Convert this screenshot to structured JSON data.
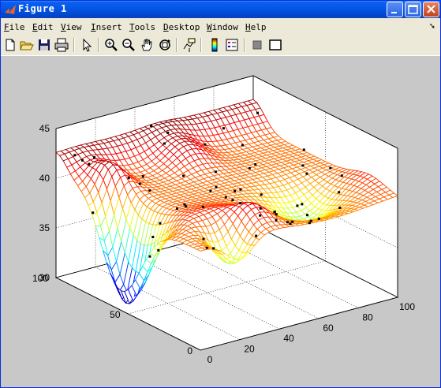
{
  "window": {
    "title": "Figure 1"
  },
  "menu": {
    "items": [
      {
        "u": "F",
        "rest": "ile"
      },
      {
        "u": "E",
        "rest": "dit"
      },
      {
        "u": "V",
        "rest": "iew"
      },
      {
        "u": "I",
        "rest": "nsert"
      },
      {
        "u": "T",
        "rest": "ools"
      },
      {
        "u": "D",
        "rest": "esktop"
      },
      {
        "u": "W",
        "rest": "indow"
      },
      {
        "u": "H",
        "rest": "elp"
      }
    ]
  },
  "toolbar": {
    "tools": [
      "new-figure-icon",
      "open-file-icon",
      "save-icon",
      "print-icon",
      "edit-plot-arrow-icon",
      "zoom-in-icon",
      "zoom-out-icon",
      "pan-hand-icon",
      "rotate-3d-icon",
      "data-cursor-icon",
      "colorbar-icon",
      "legend-icon",
      "hide-plot-tools-icon",
      "show-plot-tools-icon"
    ]
  },
  "colors": {
    "title_bar": "#0556e6",
    "figure_bg": "#c8c8c8",
    "axes_bg": "#ffffff",
    "marker": "#000000"
  },
  "chart_data": {
    "type": "surface-mesh",
    "colormap": "jet",
    "view": "3d",
    "grid": true,
    "x_ticks": [
      "0",
      "20",
      "40",
      "60",
      "80",
      "100"
    ],
    "y_ticks": [
      "0",
      "50",
      "100"
    ],
    "z_ticks": [
      "30",
      "35",
      "40",
      "45"
    ],
    "xlim": [
      0,
      100
    ],
    "ylim": [
      0,
      100
    ],
    "zlim": [
      30,
      45
    ],
    "scatter_markers": "black points overlaid on surface"
  }
}
